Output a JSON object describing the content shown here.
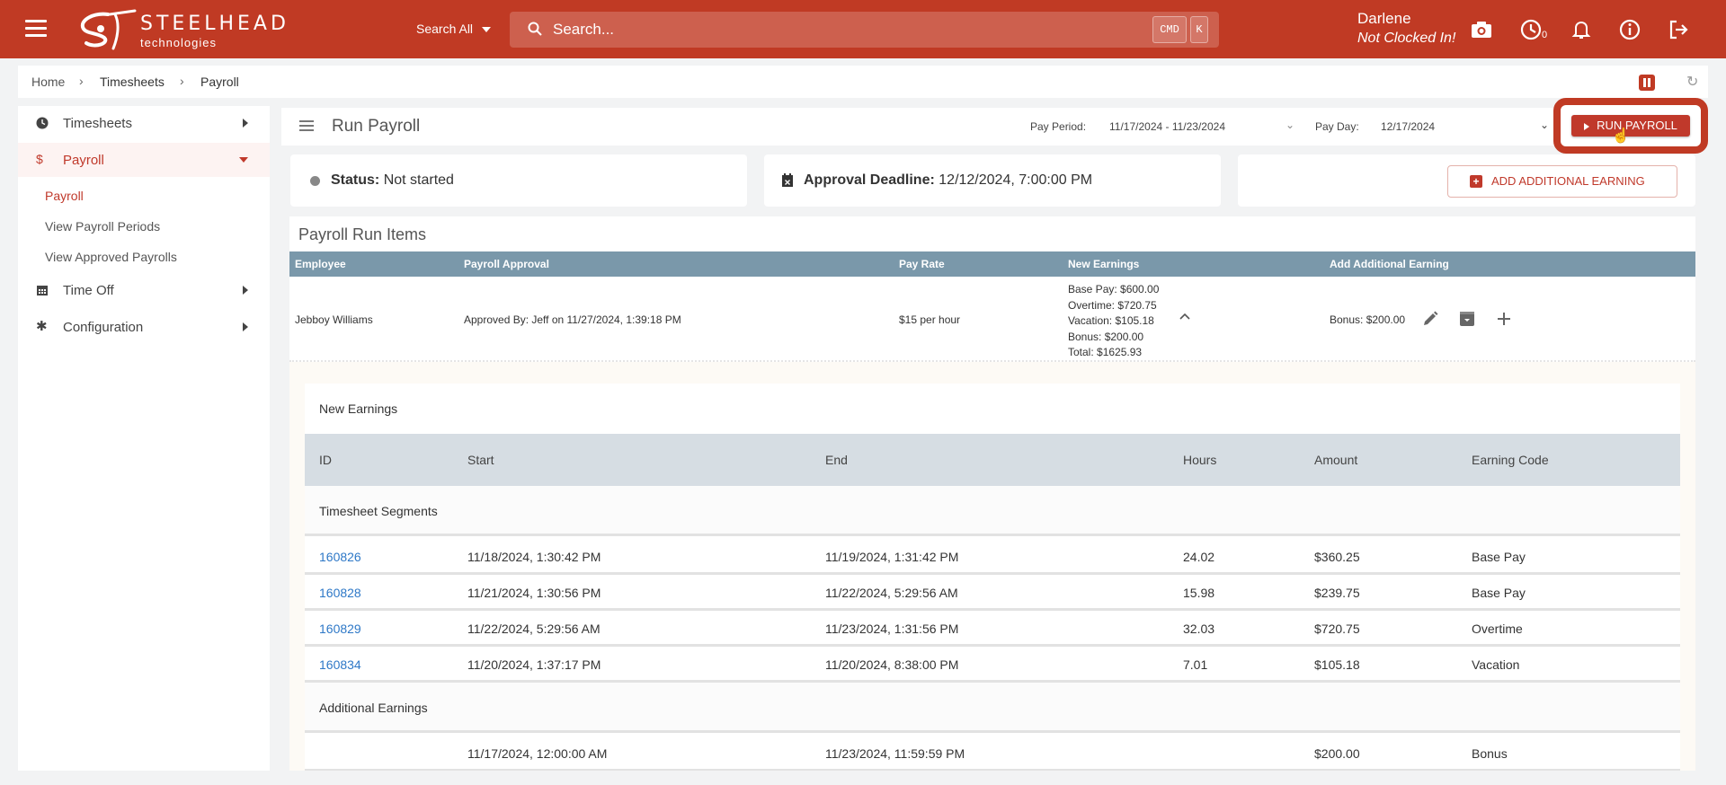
{
  "topbar": {
    "brand_title": "STEELHEAD",
    "brand_subtitle": "technologies",
    "search_scope": "Search All",
    "search_placeholder": "Search...",
    "shortcut_keys": [
      "CMD",
      "K"
    ],
    "user_name": "Darlene",
    "user_status": "Not Clocked In!",
    "clock_count": "0",
    "icons": [
      "menu-icon",
      "camera-icon",
      "clock-icon",
      "bell-icon",
      "info-icon",
      "logout-icon"
    ]
  },
  "breadcrumb": {
    "items": [
      "Home",
      "Timesheets",
      "Payroll"
    ]
  },
  "sidebar": {
    "items": [
      {
        "label": "Timesheets",
        "icon": "clock-icon"
      },
      {
        "label": "Payroll",
        "icon": "dollar-icon"
      },
      {
        "label": "Time Off",
        "icon": "calendar-icon"
      },
      {
        "label": "Configuration",
        "icon": "gear-icon"
      }
    ],
    "payroll_subitems": [
      "Payroll",
      "View Payroll Periods",
      "View Approved Payrolls"
    ]
  },
  "header": {
    "title": "Run Payroll",
    "pay_period_label": "Pay Period:",
    "pay_period_value": "11/17/2024 - 11/23/2024",
    "pay_day_label": "Pay Day:",
    "pay_day_value": "12/17/2024",
    "run_button": "RUN PAYROLL"
  },
  "cards": {
    "status_label": "Status:",
    "status_value": "Not started",
    "deadline_label": "Approval Deadline:",
    "deadline_value": "12/12/2024, 7:00:00 PM",
    "add_earning_button": "ADD ADDITIONAL EARNING"
  },
  "run_items": {
    "title": "Payroll Run Items",
    "columns": [
      "Employee",
      "Payroll Approval",
      "Pay Rate",
      "New Earnings",
      "Add Additional Earning"
    ],
    "rows": [
      {
        "employee": "Jebboy Williams",
        "approval": "Approved By: Jeff on 11/27/2024, 1:39:18 PM",
        "pay_rate": "$15 per hour",
        "earnings": [
          "Base Pay: $600.00",
          "Overtime: $720.75",
          "Vacation: $105.18",
          "Bonus: $200.00",
          "Total: $1625.93"
        ],
        "additional": "Bonus: $200.00"
      }
    ]
  },
  "details": {
    "title": "New Earnings",
    "columns": [
      "ID",
      "Start",
      "End",
      "Hours",
      "Amount",
      "Earning Code"
    ],
    "segments_label": "Timesheet Segments",
    "segments": [
      {
        "id": "160826",
        "start": "11/18/2024, 1:30:42 PM",
        "end": "11/19/2024, 1:31:42 PM",
        "hours": "24.02",
        "amount": "$360.25",
        "code": "Base Pay"
      },
      {
        "id": "160828",
        "start": "11/21/2024, 1:30:56 PM",
        "end": "11/22/2024, 5:29:56 AM",
        "hours": "15.98",
        "amount": "$239.75",
        "code": "Base Pay"
      },
      {
        "id": "160829",
        "start": "11/22/2024, 5:29:56 AM",
        "end": "11/23/2024, 1:31:56 PM",
        "hours": "32.03",
        "amount": "$720.75",
        "code": "Overtime"
      },
      {
        "id": "160834",
        "start": "11/20/2024, 1:37:17 PM",
        "end": "11/20/2024, 8:38:00 PM",
        "hours": "7.01",
        "amount": "$105.18",
        "code": "Vacation"
      }
    ],
    "additional_label": "Additional Earnings",
    "additional": [
      {
        "id": "",
        "start": "11/17/2024, 12:00:00 AM",
        "end": "11/23/2024, 11:59:59 PM",
        "hours": "",
        "amount": "$200.00",
        "code": "Bonus"
      }
    ]
  },
  "colors": {
    "brand": "#c03a24",
    "table_header": "#7a98aa",
    "link": "#2e78c7"
  }
}
